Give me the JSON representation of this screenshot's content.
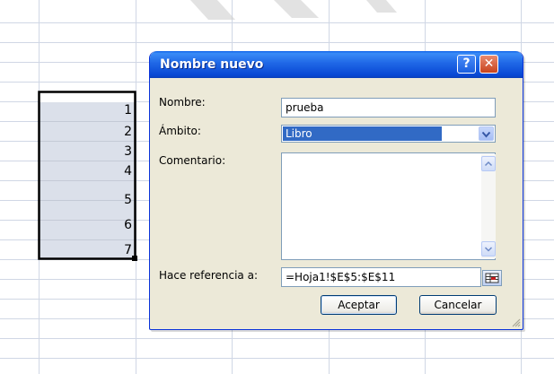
{
  "dialog": {
    "title": "Nombre nuevo",
    "help_label": "?",
    "close_label": "✕",
    "name_label": "Nombre:",
    "name_value": "prueba",
    "scope_label": "Ámbito:",
    "scope_value": "Libro",
    "comment_label": "Comentario:",
    "comment_value": "",
    "refers_label": "Hace referencia a:",
    "refers_value": "=Hoja1!$E$5:$E$11",
    "ok_label": "Aceptar",
    "cancel_label": "Cancelar"
  },
  "sheet": {
    "cells": [
      "1",
      "2",
      "3",
      "4",
      "5",
      "6",
      "7"
    ],
    "selection_fill": "#dbe0ea",
    "grid_color": "#d0d7e5"
  }
}
